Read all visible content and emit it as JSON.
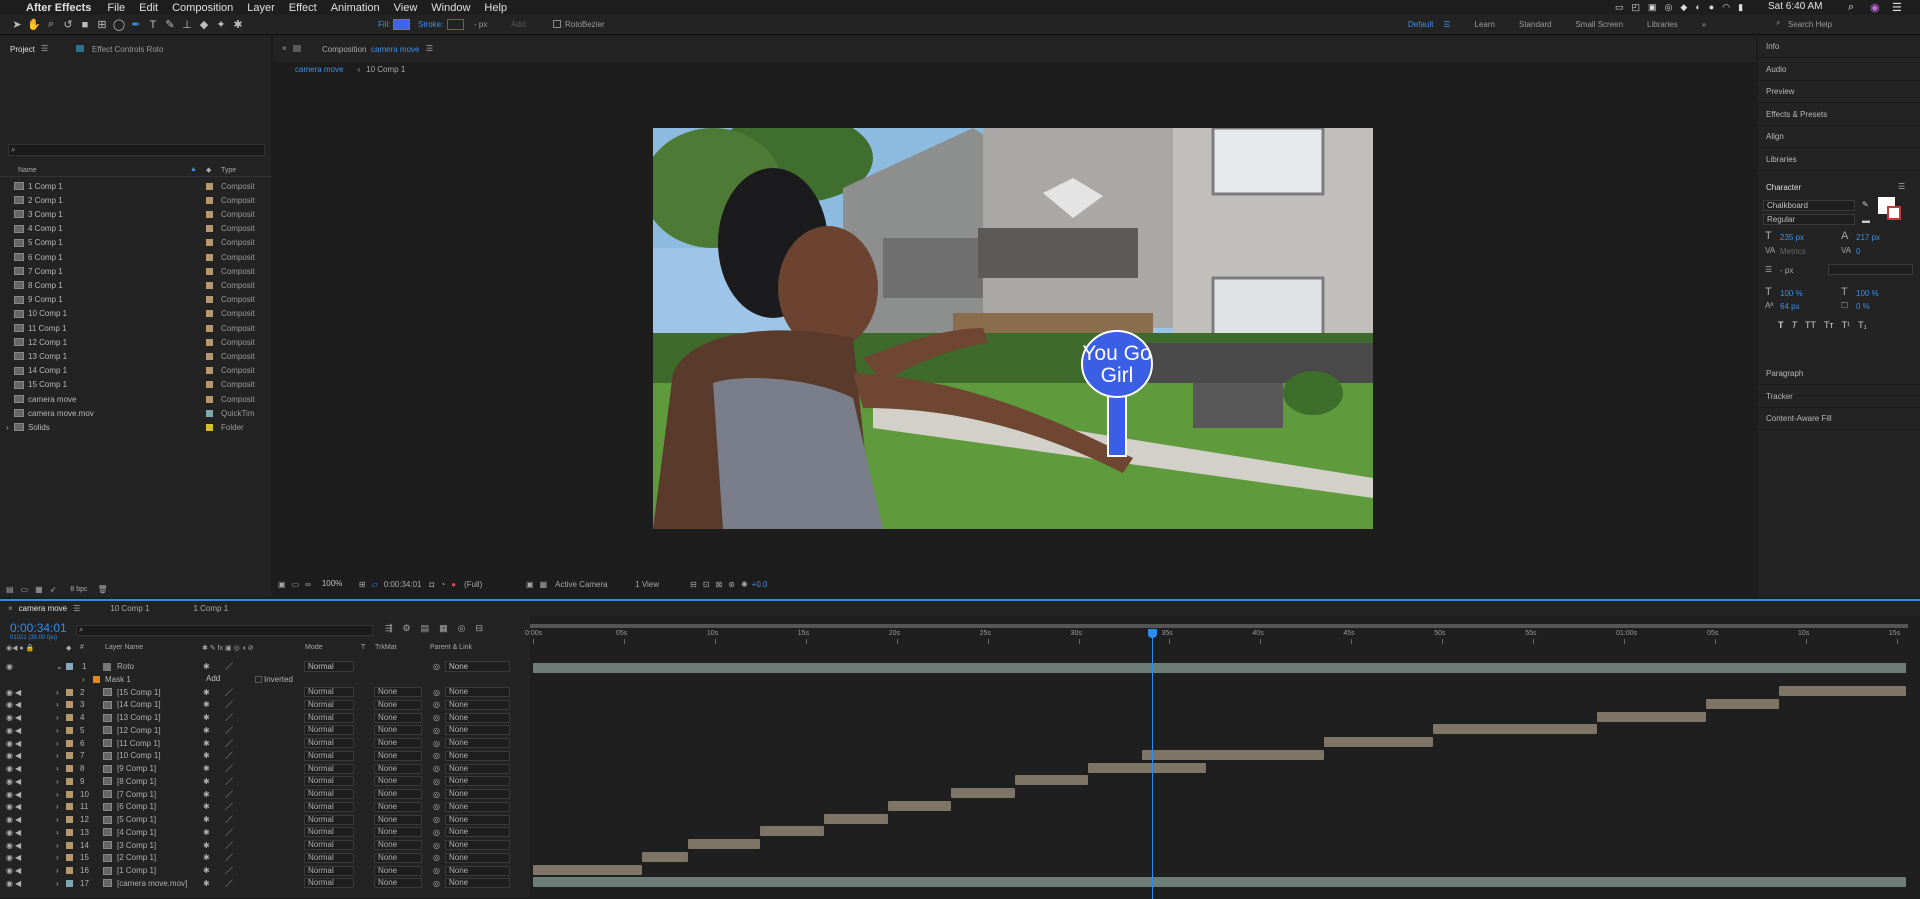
{
  "menubar": {
    "app": "After Effects",
    "menus": [
      "File",
      "Edit",
      "Composition",
      "Layer",
      "Effect",
      "Animation",
      "View",
      "Window",
      "Help"
    ],
    "clock": "Sat 6:40 AM"
  },
  "toolbar": {
    "fill_label": "Fill:",
    "stroke_label": "Stroke:",
    "stroke_px": "- px",
    "add_label": "Add:",
    "rotobezier_label": "RotoBezier",
    "workspaces": [
      "Default",
      "Learn",
      "Standard",
      "Small Screen",
      "Libraries"
    ],
    "search_placeholder": "Search Help"
  },
  "project": {
    "tab_project": "Project",
    "tab_effect_controls": "Effect Controls Roto",
    "col_name": "Name",
    "col_type": "Type",
    "items": [
      {
        "name": "1 Comp 1",
        "type": "Composit"
      },
      {
        "name": "2 Comp 1",
        "type": "Composit"
      },
      {
        "name": "3 Comp 1",
        "type": "Composit"
      },
      {
        "name": "4 Comp 1",
        "type": "Composit"
      },
      {
        "name": "5 Comp 1",
        "type": "Composit"
      },
      {
        "name": "6 Comp 1",
        "type": "Composit"
      },
      {
        "name": "7 Comp 1",
        "type": "Composit"
      },
      {
        "name": "8 Comp 1",
        "type": "Composit"
      },
      {
        "name": "9 Comp 1",
        "type": "Composit"
      },
      {
        "name": "10 Comp 1",
        "type": "Composit"
      },
      {
        "name": "11 Comp 1",
        "type": "Composit"
      },
      {
        "name": "12 Comp 1",
        "type": "Composit"
      },
      {
        "name": "13 Comp 1",
        "type": "Composit"
      },
      {
        "name": "14 Comp 1",
        "type": "Composit"
      },
      {
        "name": "15 Comp 1",
        "type": "Composit"
      },
      {
        "name": "camera move",
        "type": "Composit"
      },
      {
        "name": "camera move.mov",
        "type": "QuickTim"
      },
      {
        "name": "Solids",
        "type": "Folder"
      }
    ],
    "bpc": "8 bpc",
    "colors": {
      "composition": "#b39870",
      "quicktime": "#7fa7b0",
      "folder": "#d6c12a"
    }
  },
  "composition": {
    "tab_prefix": "Composition",
    "tab_name": "camera move",
    "breadcrumbs": [
      "camera move",
      "10 Comp 1"
    ],
    "sign_text_1": "You Go",
    "sign_text_2": "Girl",
    "zoom": "100%",
    "timecode": "0:00:34:01",
    "resolution": "(Full)",
    "camera": "Active Camera",
    "view": "1 View",
    "exposure": "+0.0"
  },
  "right_panels": {
    "items": [
      "Info",
      "Audio",
      "Preview",
      "Effects & Presets",
      "Align",
      "Libraries"
    ],
    "character": {
      "title": "Character",
      "font": "Chalkboard",
      "style": "Regular",
      "size": "235 px",
      "leading": "217 px",
      "kerning": "Metrics",
      "tracking": "0",
      "stroke_width": "- px",
      "vscale": "100 %",
      "hscale": "100 %",
      "baseline": "64 px",
      "tsume": "0 %",
      "styles": [
        "T",
        "T",
        "TT",
        "Tт",
        "T¹",
        "T₁"
      ]
    },
    "bottom_items": [
      "Paragraph",
      "Tracker",
      "Content-Aware Fill"
    ]
  },
  "timeline": {
    "tabs": [
      "camera move",
      "10 Comp 1",
      "1 Comp 1"
    ],
    "timecode": "0:00:34:01",
    "fps": "01021 (30.00 fps)",
    "headers": {
      "layer_name": "Layer Name",
      "mode": "Mode",
      "t": "T",
      "trkmat": "TrkMat",
      "parent": "Parent & Link"
    },
    "ruler_labels": [
      "0:00s",
      "05s",
      "10s",
      "15s",
      "20s",
      "25s",
      "30s",
      "35s",
      "40s",
      "45s",
      "50s",
      "55s",
      "01:00s",
      "05s",
      "10s",
      "15s"
    ],
    "playhead_seconds": 34.03,
    "duration_seconds": 75.5,
    "roto_layer": {
      "num": "1",
      "name": "Roto",
      "mode": "Normal",
      "parent": "None"
    },
    "mask": {
      "name": "Mask 1",
      "mode": "Add",
      "inverted": "Inverted"
    },
    "layers": [
      {
        "num": "2",
        "name": "[15 Comp 1]",
        "mode": "Normal",
        "trkmat": "None",
        "parent": "None",
        "start": 68.5,
        "end": 75.5
      },
      {
        "num": "3",
        "name": "[14 Comp 1]",
        "mode": "Normal",
        "trkmat": "None",
        "parent": "None",
        "start": 64.5,
        "end": 68.5
      },
      {
        "num": "4",
        "name": "[13 Comp 1]",
        "mode": "Normal",
        "trkmat": "None",
        "parent": "None",
        "start": 58.5,
        "end": 64.5
      },
      {
        "num": "5",
        "name": "[12 Comp 1]",
        "mode": "Normal",
        "trkmat": "None",
        "parent": "None",
        "start": 49.5,
        "end": 58.5
      },
      {
        "num": "6",
        "name": "[11 Comp 1]",
        "mode": "Normal",
        "trkmat": "None",
        "parent": "None",
        "start": 43.5,
        "end": 49.5
      },
      {
        "num": "7",
        "name": "[10 Comp 1]",
        "mode": "Normal",
        "trkmat": "None",
        "parent": "None",
        "start": 33.5,
        "end": 43.5
      },
      {
        "num": "8",
        "name": "[9 Comp 1]",
        "mode": "Normal",
        "trkmat": "None",
        "parent": "None",
        "start": 30.5,
        "end": 37
      },
      {
        "num": "9",
        "name": "[8 Comp 1]",
        "mode": "Normal",
        "trkmat": "None",
        "parent": "None",
        "start": 26.5,
        "end": 30.5
      },
      {
        "num": "10",
        "name": "[7 Comp 1]",
        "mode": "Normal",
        "trkmat": "None",
        "parent": "None",
        "start": 23,
        "end": 26.5
      },
      {
        "num": "11",
        "name": "[6 Comp 1]",
        "mode": "Normal",
        "trkmat": "None",
        "parent": "None",
        "start": 19.5,
        "end": 23
      },
      {
        "num": "12",
        "name": "[5 Comp 1]",
        "mode": "Normal",
        "trkmat": "None",
        "parent": "None",
        "start": 16,
        "end": 19.5
      },
      {
        "num": "13",
        "name": "[4 Comp 1]",
        "mode": "Normal",
        "trkmat": "None",
        "parent": "None",
        "start": 12.5,
        "end": 16
      },
      {
        "num": "14",
        "name": "[3 Comp 1]",
        "mode": "Normal",
        "trkmat": "None",
        "parent": "None",
        "start": 8.5,
        "end": 12.5
      },
      {
        "num": "15",
        "name": "[2 Comp 1]",
        "mode": "Normal",
        "trkmat": "None",
        "parent": "None",
        "start": 6,
        "end": 8.5
      },
      {
        "num": "16",
        "name": "[1 Comp 1]",
        "mode": "Normal",
        "trkmat": "None",
        "parent": "None",
        "start": 0,
        "end": 6
      },
      {
        "num": "17",
        "name": "[camera move.mov]",
        "mode": "Normal",
        "trkmat": "None",
        "parent": "None",
        "start": 0,
        "end": 75.5
      }
    ],
    "colors": {
      "accent": "#2d8ceb",
      "comp_bar": "#7f7567",
      "footage_bar": "#6d7e79"
    }
  }
}
